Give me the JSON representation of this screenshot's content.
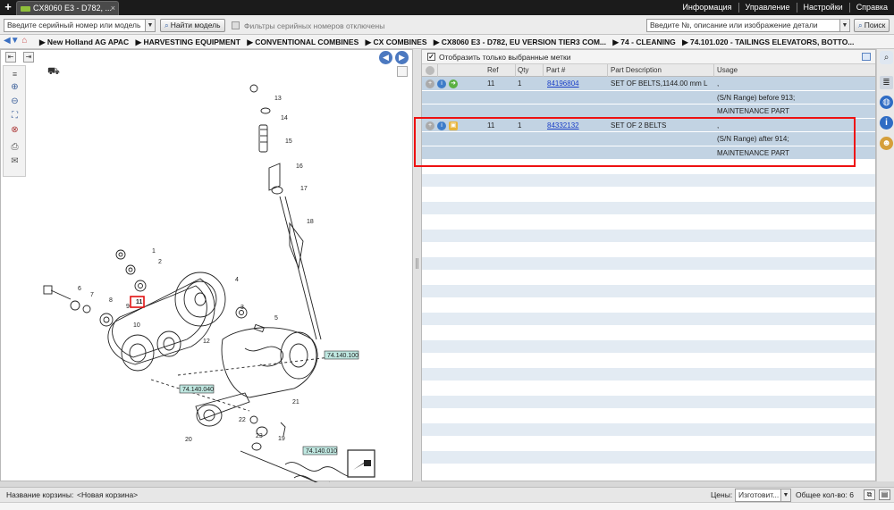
{
  "topbar": {
    "tab_title": "CX8060 E3 - D782, ...",
    "menu": [
      "Информация",
      "Управление",
      "Настройки",
      "Справка"
    ]
  },
  "search": {
    "model_placeholder": "Введите серийный номер или модель",
    "find_model_label": "Найти модель",
    "filter_label": "Фильтры серийных номеров отключены",
    "part_placeholder": "Введите №, описание или изображение детали",
    "search_label": "Поиск"
  },
  "breadcrumb": [
    "▶ New Holland AG APAC",
    "▶ HARVESTING EQUIPMENT",
    "▶ CONVENTIONAL COMBINES",
    "▶ CX COMBINES",
    "▶ CX8060 E3 - D782, EU VERSION TIER3 COM...",
    "▶ 74 - CLEANING",
    "▶ 74.101.020 - TAILINGS ELEVATORS, BOTTO..."
  ],
  "diagram": {
    "numbers": [
      "1",
      "2",
      "3",
      "4",
      "5",
      "6",
      "7",
      "8",
      "9",
      "10",
      "11",
      "12",
      "13",
      "14",
      "15",
      "16",
      "17",
      "18",
      "19",
      "20",
      "21",
      "22",
      "23"
    ],
    "highlight_label": "11",
    "refs": [
      "74.140.100",
      "74.140.040",
      "74.140.010"
    ]
  },
  "parts": {
    "show_selected_label": "Отобразить только выбранные метки",
    "columns": [
      "Ref",
      "Qty",
      "Part #",
      "Part Description",
      "Usage"
    ],
    "rows": [
      {
        "ref": "11",
        "qty": "1",
        "part": "84196804",
        "desc": "SET OF BELTS,1144.00 mm L",
        "usage": [
          ",",
          "(S/N Range) before 913;",
          "MAINTENANCE PART"
        ]
      },
      {
        "ref": "11",
        "qty": "1",
        "part": "84332132",
        "desc": "SET OF 2 BELTS",
        "usage": [
          ",",
          "(S/N Range) after 914;",
          "MAINTENANCE PART"
        ]
      }
    ]
  },
  "footer": {
    "cart_label": "Название корзины:",
    "cart_value": "<Новая корзина>",
    "prices_label": "Цены:",
    "prices_value": "Изготовит...",
    "total_label": "Общее кол-во: 6"
  },
  "colors": {
    "accent": "#4c79c0",
    "highlight": "#e11111",
    "row_selected": "#c2d3e3"
  }
}
